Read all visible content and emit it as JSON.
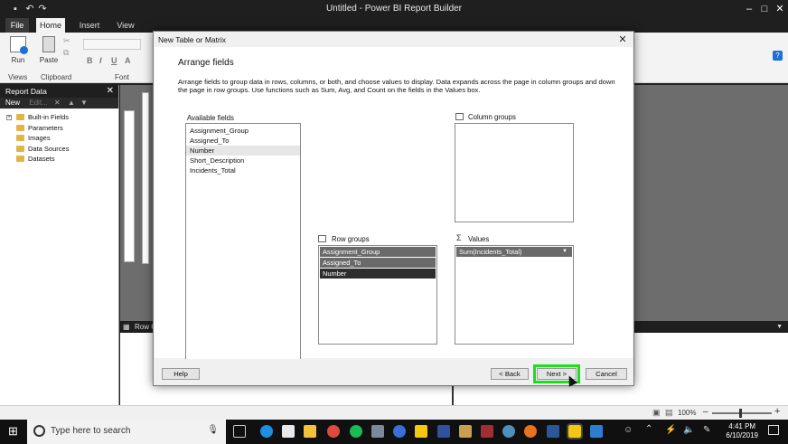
{
  "app": {
    "title": "Untitled - Power BI Report Builder"
  },
  "ribbon": {
    "tabs": [
      "File",
      "Home",
      "Insert",
      "View"
    ],
    "buttons": {
      "run": "Run",
      "paste": "Paste"
    },
    "groups": {
      "views": "Views",
      "clipboard": "Clipboard",
      "font": "Font"
    },
    "font_buttons": [
      "B",
      "I",
      "U",
      "A"
    ]
  },
  "report_data": {
    "title": "Report Data",
    "new_label": "New",
    "edit_label": "Edit...",
    "items": [
      "Built-in Fields",
      "Parameters",
      "Images",
      "Data Sources",
      "Datasets"
    ]
  },
  "canvas": {
    "row_groups_bar": "Row G"
  },
  "dialog": {
    "title": "New Table or Matrix",
    "heading": "Arrange fields",
    "description": "Arrange fields to group data in rows, columns, or both, and choose values to display. Data expands across the page in column groups and down the page in row groups.  Use functions such as Sum, Avg, and Count on the fields in the Values box.",
    "available_fields_label": "Available fields",
    "available_fields": [
      "Assignment_Group",
      "Assigned_To",
      "Number",
      "Short_Description",
      "Incidents_Total"
    ],
    "selected_available_index": 2,
    "column_groups_label": "Column groups",
    "row_groups_label": "Row groups",
    "row_groups": [
      "Assignment_Group",
      "Assigned_To",
      "Number"
    ],
    "values_label": "Values",
    "values": [
      "Sum(Incidents_Total)"
    ],
    "buttons": {
      "help": "Help",
      "back": "< Back",
      "next": "Next >",
      "cancel": "Cancel"
    }
  },
  "status": {
    "zoom": "100%"
  },
  "taskbar": {
    "search_placeholder": "Type here to search",
    "time": "4:41 PM",
    "date": "6/10/2019"
  },
  "colors": {
    "highlight": "#19e019",
    "row_group_item": "#6a6a6a",
    "row_group_selected": "#2d2d2d"
  }
}
